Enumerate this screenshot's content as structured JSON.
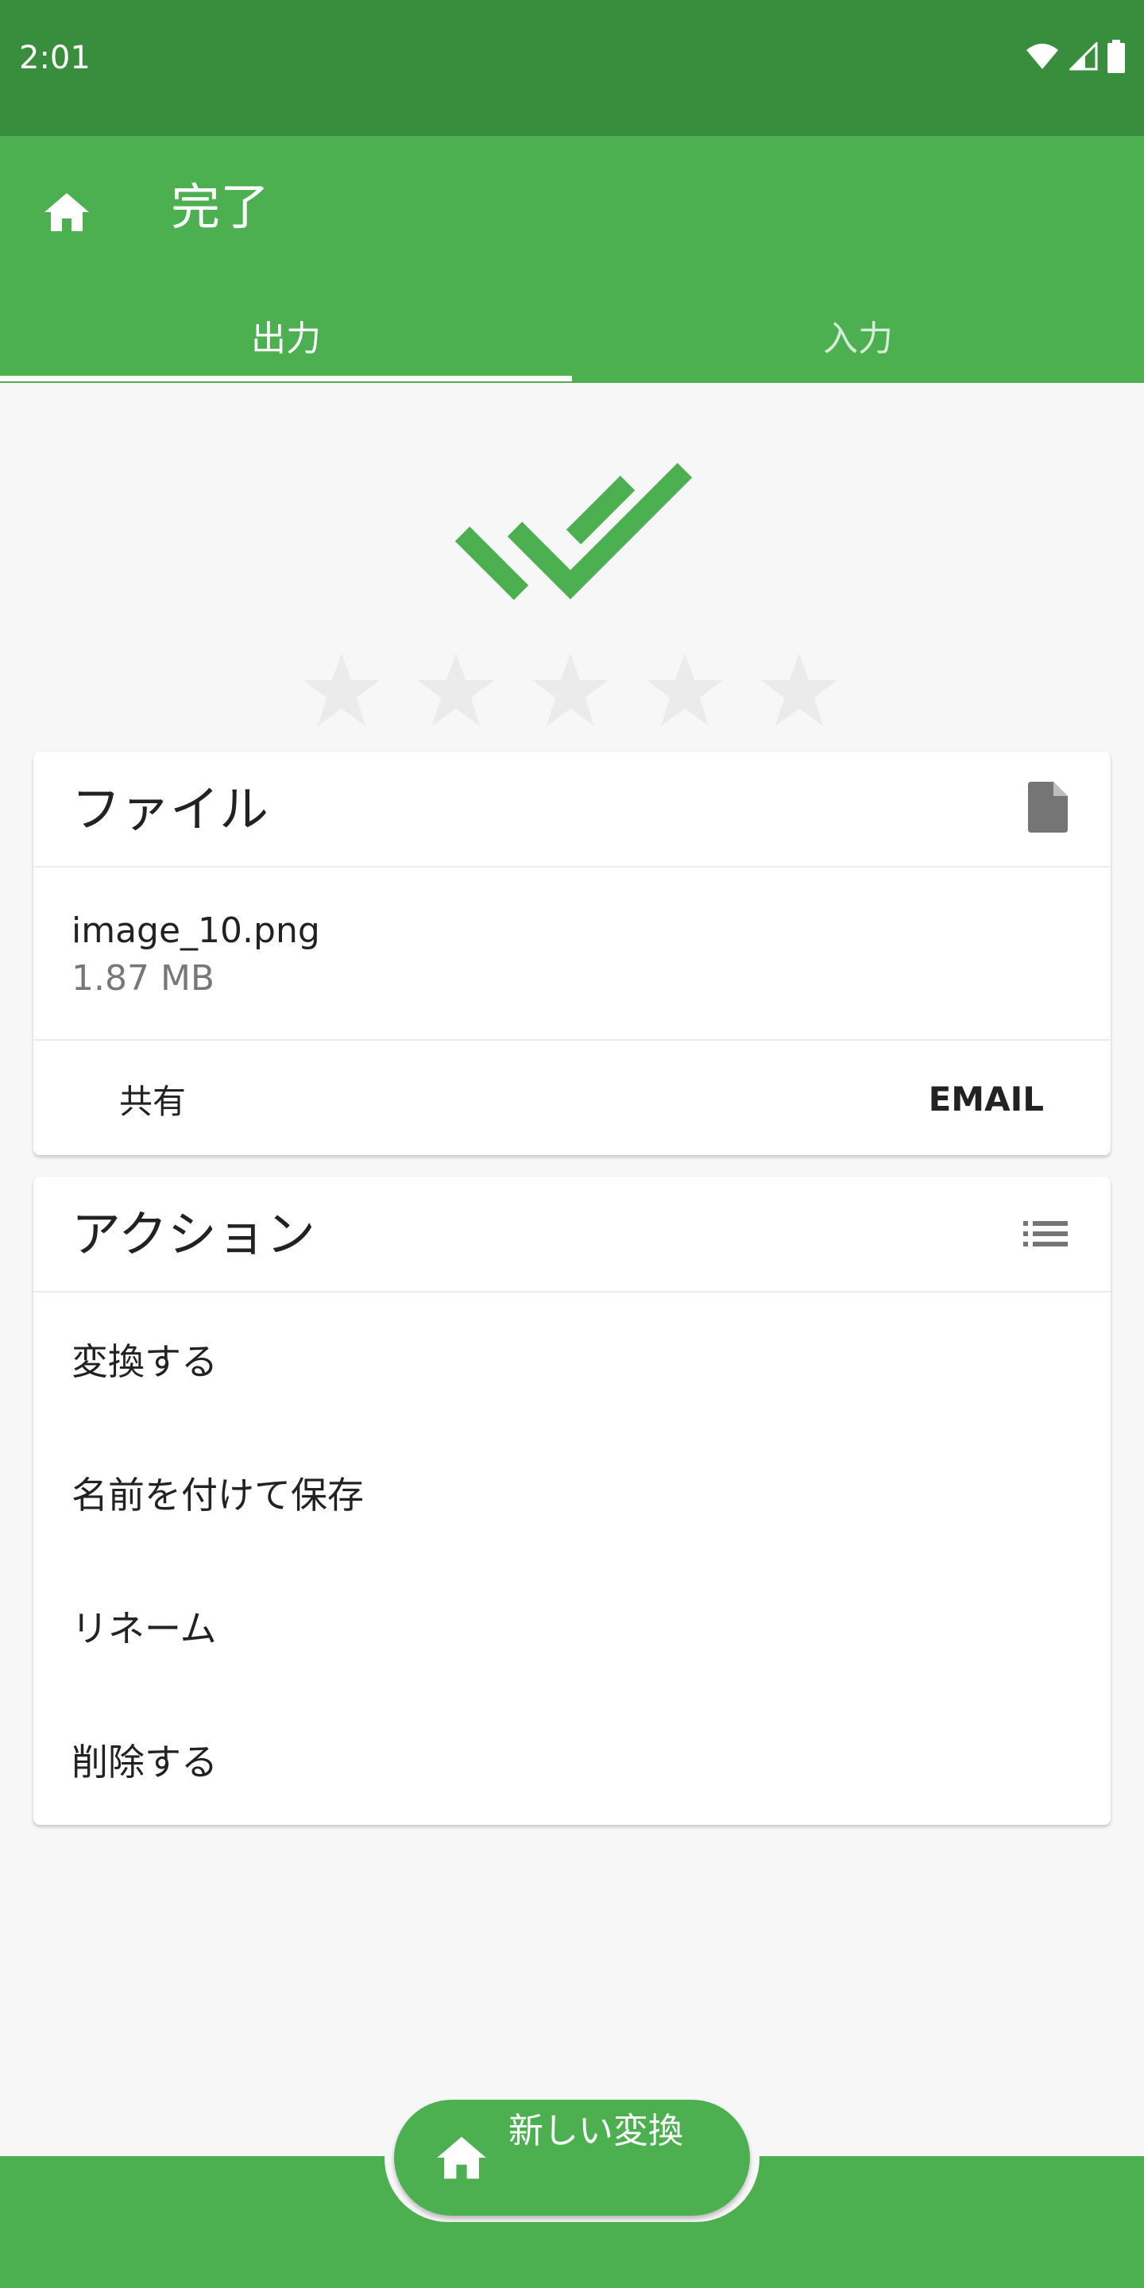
{
  "status_bar": {
    "time": "2:01"
  },
  "app_bar": {
    "title": "完了"
  },
  "tabs": [
    {
      "label": "出力"
    },
    {
      "label": "入力"
    }
  ],
  "rating": {
    "value": 0,
    "max": 5
  },
  "file_card": {
    "title": "ファイル",
    "file_name": "image_10.png",
    "file_size": "1.87 MB",
    "share_label": "共有",
    "email_label": "EMAIL"
  },
  "actions_card": {
    "title": "アクション",
    "items": [
      {
        "label": "変換する"
      },
      {
        "label": "名前を付けて保存"
      },
      {
        "label": "リネーム"
      },
      {
        "label": "削除する"
      }
    ]
  },
  "fab": {
    "label": "新しい変換"
  },
  "colors": {
    "primary": "#4caf50",
    "primary_dark": "#388e3c",
    "background": "#f7f7f7"
  },
  "icons": {
    "home": "home-icon",
    "check": "double-check-icon",
    "star": "star-icon",
    "file": "file-icon",
    "list": "list-icon",
    "wifi": "wifi-icon",
    "signal": "signal-icon",
    "battery": "battery-icon"
  }
}
